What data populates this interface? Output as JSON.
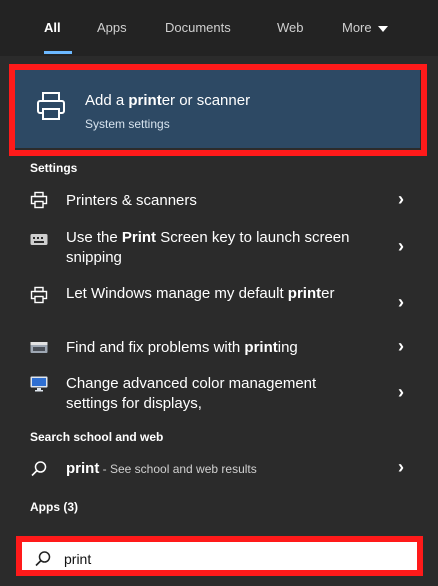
{
  "tabs": [
    {
      "label": "All"
    },
    {
      "label": "Apps"
    },
    {
      "label": "Documents"
    },
    {
      "label": "Web"
    },
    {
      "label": "More"
    }
  ],
  "best_match": {
    "title_pre": "Add a ",
    "title_bold": "print",
    "title_post": "er or scanner",
    "subtitle": "System settings"
  },
  "settings_section": "Settings",
  "settings_items": [
    {
      "pre": "Printers & scanners",
      "bold": "",
      "post": ""
    },
    {
      "pre": "Use the ",
      "bold": "Print",
      "post": " Screen key to launch screen snipping"
    },
    {
      "pre": "Let Windows manage my default ",
      "bold": "print",
      "post": "er"
    },
    {
      "pre": "Find and fix problems with ",
      "bold": "print",
      "post": "ing"
    },
    {
      "pre": "Change advanced color management settings for displays,",
      "bold": "",
      "post": ""
    }
  ],
  "web_section": "Search school and web",
  "web_item": {
    "query": "print",
    "suffix": " - See school and web results"
  },
  "apps_section": "Apps (3)",
  "search": {
    "value": "print"
  },
  "icons": {
    "printer": "printer-icon",
    "keyboard": "keyboard-icon",
    "troubleshoot": "troubleshoot-icon",
    "monitor": "monitor-icon",
    "search": "search-icon",
    "chevron": "chevron-right-icon"
  }
}
